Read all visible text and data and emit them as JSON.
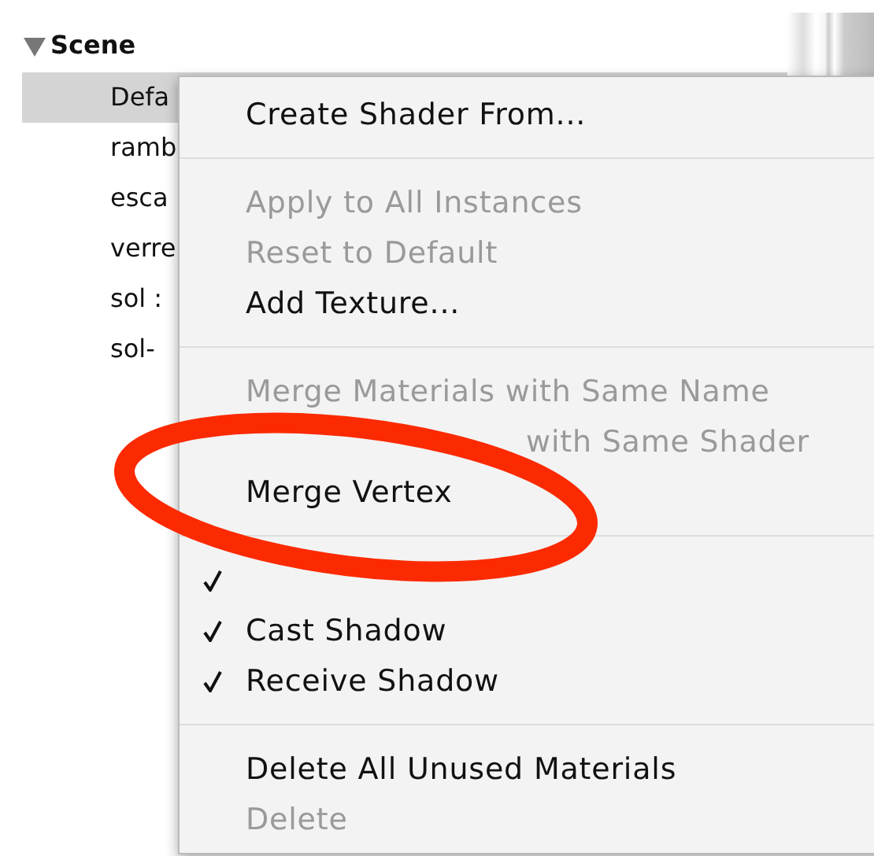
{
  "outline": {
    "root": {
      "label": "Scene",
      "expanded": true,
      "children": [
        {
          "label": "Defa",
          "selected": true
        },
        {
          "label": "ramb",
          "selected": false
        },
        {
          "label": "esca",
          "selected": false
        },
        {
          "label": "verre",
          "selected": false
        },
        {
          "label": "sol :",
          "selected": false
        },
        {
          "label": "sol-",
          "selected": false
        }
      ]
    }
  },
  "context_menu": {
    "items": [
      {
        "kind": "item",
        "label": "Create Shader From...",
        "disabled": false,
        "checked": false
      },
      {
        "kind": "separator"
      },
      {
        "kind": "item",
        "label": "Apply to All Instances",
        "disabled": true,
        "checked": false
      },
      {
        "kind": "item",
        "label": "Reset to Default",
        "disabled": true,
        "checked": false
      },
      {
        "kind": "item",
        "label": "Add Texture...",
        "disabled": false,
        "checked": false
      },
      {
        "kind": "separator"
      },
      {
        "kind": "item",
        "label": "Merge Materials with Same Name",
        "disabled": true,
        "checked": false
      },
      {
        "kind": "partly_hidden",
        "label": "with Same Shader",
        "disabled": true,
        "checked": false
      },
      {
        "kind": "item",
        "label": "Merge Vertex",
        "disabled": false,
        "checked": false
      },
      {
        "kind": "separator"
      },
      {
        "kind": "hidden",
        "checked": true
      },
      {
        "kind": "item",
        "label": "Cast Shadow",
        "disabled": false,
        "checked": true
      },
      {
        "kind": "item",
        "label": "Receive Shadow",
        "disabled": false,
        "checked": true
      },
      {
        "kind": "separator"
      },
      {
        "kind": "item",
        "label": "Delete All Unused Materials",
        "disabled": false,
        "checked": false
      },
      {
        "kind": "item",
        "label": "Delete",
        "disabled": true,
        "checked": false
      }
    ]
  }
}
